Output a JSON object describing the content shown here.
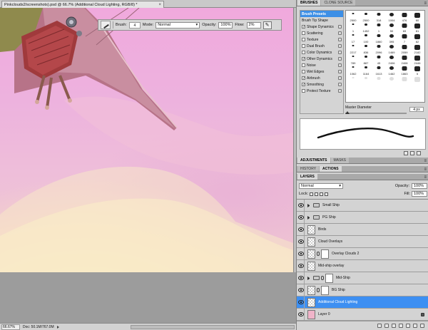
{
  "document": {
    "tab_title": "Pinkclouds2/screenshots).psd @ 66.7% (Additional Cloud Lighting, RGB/8) *",
    "status": {
      "zoom": "66.67%",
      "doc_size": "Doc: 50.1M/767.0M"
    }
  },
  "options_bar": {
    "brush_label": "Brush:",
    "brush_size": "4",
    "mode_label": "Mode:",
    "mode_value": "Normal",
    "opacity_label": "Opacity:",
    "opacity_value": "100%",
    "flow_label": "Flow:",
    "flow_value": "2%"
  },
  "brushes_panel": {
    "tabs": [
      "BRUSHES",
      "CLONE SOURCE"
    ],
    "presets_label": "Brush Presets",
    "settings": [
      {
        "label": "Brush Tip Shape",
        "checked": null
      },
      {
        "label": "Shape Dynamics",
        "checked": true
      },
      {
        "label": "Scattering",
        "checked": false
      },
      {
        "label": "Texture",
        "checked": false
      },
      {
        "label": "Dual Brush",
        "checked": false
      },
      {
        "label": "Color Dynamics",
        "checked": false
      },
      {
        "label": "Other Dynamics",
        "checked": true
      },
      {
        "label": "Noise",
        "checked": false
      },
      {
        "label": "Wet Edges",
        "checked": false
      },
      {
        "label": "Airbrush",
        "checked": true
      },
      {
        "label": "Smoothing",
        "checked": true
      },
      {
        "label": "Protect Texture",
        "checked": false
      }
    ],
    "tip_sizes": [
      "2500",
      "2500",
      "318",
      "1004",
      "476",
      "60",
      "1",
      "1452",
      "1",
      "50",
      "69",
      "81",
      "17",
      "100",
      "1860",
      "395",
      "7",
      "82",
      "2217",
      "836",
      "2096",
      "1469",
      "2059",
      "2182",
      "789",
      "887",
      "45",
      "2406",
      "2408",
      "2446",
      "1062",
      "1164",
      "1613",
      "1462",
      "1863",
      "5",
      "",
      "",
      "",
      "",
      "",
      ""
    ],
    "master_diameter_label": "Master Diameter",
    "master_diameter_value": "4 px"
  },
  "adjustments_panel": {
    "tabs": [
      "ADJUSTMENTS",
      "MASKS"
    ]
  },
  "history_panel": {
    "tabs": [
      "HISTORY",
      "ACTIONS"
    ]
  },
  "layers_panel": {
    "tab": "LAYERS",
    "blend_mode": "Normal",
    "opacity_label": "Opacity:",
    "opacity_value": "100%",
    "lock_label": "Lock:",
    "fill_label": "Fill:",
    "fill_value": "100%",
    "layers": [
      {
        "name": "Small Ship",
        "type": "group"
      },
      {
        "name": "PG Ship",
        "type": "group"
      },
      {
        "name": "Birds",
        "type": "layer"
      },
      {
        "name": "Cloud Overlays",
        "type": "layer"
      },
      {
        "name": "Overlay Clouds 2",
        "type": "masked"
      },
      {
        "name": "Mid-ship overlay",
        "type": "layer"
      },
      {
        "name": "Mid-Ship",
        "type": "group-masked"
      },
      {
        "name": "BG Ship",
        "type": "masked"
      },
      {
        "name": "Additional Cloud Lighting",
        "type": "layer",
        "selected": true
      },
      {
        "name": "Layer 0",
        "type": "background"
      }
    ]
  },
  "colors": {
    "accent": "#3d8ff2",
    "panel": "#d4d4d4",
    "sky": "#f0a9dd"
  }
}
